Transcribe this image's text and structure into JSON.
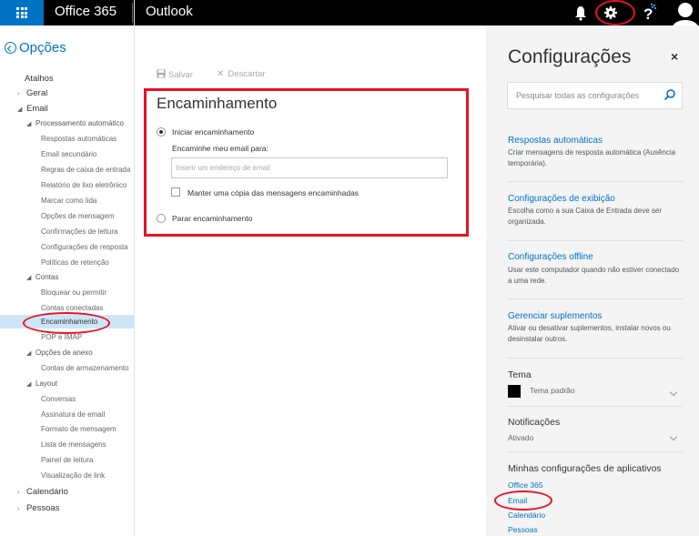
{
  "topbar": {
    "brand": "Office 365",
    "app": "Outlook"
  },
  "nav": {
    "back_label": "Opções",
    "items": [
      {
        "label": "Atalhos"
      },
      {
        "label": "Geral"
      },
      {
        "label": "Email"
      },
      {
        "label": "Processamento automático"
      },
      {
        "label": "Respostas automáticas"
      },
      {
        "label": "Email secundário"
      },
      {
        "label": "Regras de caixa de entrada"
      },
      {
        "label": "Relatório de lixo eletrônico"
      },
      {
        "label": "Marcar como lida"
      },
      {
        "label": "Opções de mensagem"
      },
      {
        "label": "Confirmações de leitura"
      },
      {
        "label": "Configurações de resposta"
      },
      {
        "label": "Políticas de retenção"
      },
      {
        "label": "Contas"
      },
      {
        "label": "Bloquear ou permitir"
      },
      {
        "label": "Contas conectadas"
      },
      {
        "label": "Encaminhamento"
      },
      {
        "label": "POP e IMAP"
      },
      {
        "label": "Opções de anexo"
      },
      {
        "label": "Contas de armazenamento"
      },
      {
        "label": "Layout"
      },
      {
        "label": "Conversas"
      },
      {
        "label": "Assinatura de email"
      },
      {
        "label": "Formato de mensagem"
      },
      {
        "label": "Lista de mensagens"
      },
      {
        "label": "Painel de leitura"
      },
      {
        "label": "Visualização de link"
      },
      {
        "label": "Calendário"
      },
      {
        "label": "Pessoas"
      }
    ]
  },
  "main": {
    "toolbar": {
      "save": "Salvar",
      "discard": "Descartar"
    },
    "title": "Encaminhamento",
    "start_forwarding": "Iniciar encaminhamento",
    "forward_to_label": "Encaminhe meu email para:",
    "email_placeholder": "Inserir um endereço de email",
    "keep_copy": "Manter uma cópia das mensagens encaminhadas",
    "stop_forwarding": "Parar encaminhamento",
    "start_selected": true,
    "keep_copy_checked": false
  },
  "settings": {
    "title": "Configurações",
    "close": "×",
    "search_placeholder": "Pesquisar todas as configurações",
    "sections": [
      {
        "link": "Respostas automáticas",
        "desc": "Criar mensagens de resposta automática (Ausência temporária)."
      },
      {
        "link": "Configurações de exibição",
        "desc": "Escolha como a sua Caixa de Entrada deve ser organizada."
      },
      {
        "link": "Configurações offline",
        "desc": "Usar este computador quando não estiver conectado a uma rede."
      },
      {
        "link": "Gerenciar suplementos",
        "desc": "Ativar ou desativar suplementos, instalar novos ou desinstalar outros."
      }
    ],
    "theme_label": "Tema",
    "theme_value": "Tema padrão",
    "notifications_label": "Notificações",
    "notifications_value": "Ativado",
    "apps_label": "Minhas configurações de aplicativos",
    "apps": [
      "Office 365",
      "Email",
      "Calendário",
      "Pessoas"
    ]
  },
  "colors": {
    "accent": "#0072c6",
    "highlight": "#e81123",
    "topbar": "#000000",
    "selected_nav": "#cde6f7"
  }
}
